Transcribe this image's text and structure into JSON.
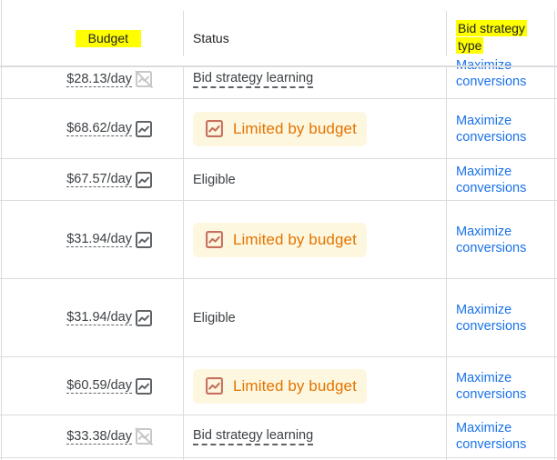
{
  "header": {
    "budget": "Budget",
    "status": "Status",
    "bid_strategy_type_line1": "Bid strategy",
    "bid_strategy_type_line2": "type"
  },
  "colors": {
    "highlight": "#ffff00",
    "link": "#1a73e8",
    "limited_text": "#e37400",
    "limited_bg": "#fef7e0",
    "limited_icon": "#c5705d",
    "grid": "#dadce0"
  },
  "rows": [
    {
      "budget": "$28.13/day",
      "budget_icon": "chart-disabled-icon",
      "status": "Bid strategy learning",
      "status_type": "learning",
      "bid_line1": "Maximize",
      "bid_line2": "conversions"
    },
    {
      "budget": "$68.62/day",
      "budget_icon": "chart-icon",
      "status": "Limited by budget",
      "status_type": "limited",
      "bid_line1": "Maximize",
      "bid_line2": "conversions"
    },
    {
      "budget": "$67.57/day",
      "budget_icon": "chart-icon",
      "status": "Eligible",
      "status_type": "eligible",
      "bid_line1": "Maximize",
      "bid_line2": "conversions"
    },
    {
      "budget": "$31.94/day",
      "budget_icon": "chart-icon",
      "status": "Limited by budget",
      "status_type": "limited",
      "bid_line1": "Maximize",
      "bid_line2": "conversions"
    },
    {
      "budget": "$31.94/day",
      "budget_icon": "chart-icon",
      "status": "Eligible",
      "status_type": "eligible",
      "bid_line1": "Maximize",
      "bid_line2": "conversions"
    },
    {
      "budget": "$60.59/day",
      "budget_icon": "chart-icon",
      "status": "Limited by budget",
      "status_type": "limited",
      "bid_line1": "Maximize",
      "bid_line2": "conversions"
    },
    {
      "budget": "$33.38/day",
      "budget_icon": "chart-disabled-icon",
      "status": "Bid strategy learning",
      "status_type": "learning",
      "bid_line1": "Maximize",
      "bid_line2": "conversions"
    }
  ]
}
